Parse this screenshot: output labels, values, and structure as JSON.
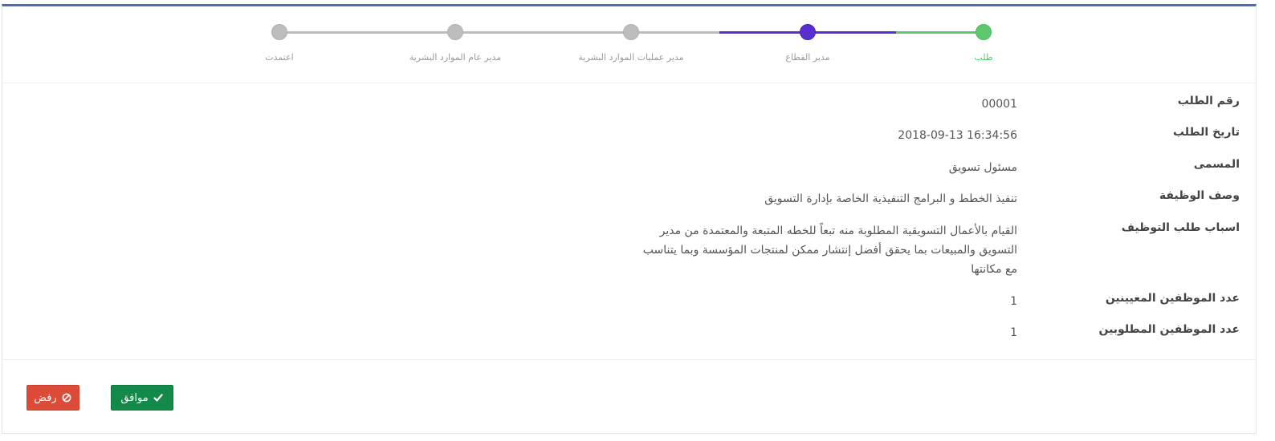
{
  "stepper": {
    "steps": [
      {
        "label": "طلب",
        "state": "done"
      },
      {
        "label": "مدير القطاع",
        "state": "active"
      },
      {
        "label": "مدير عمليات الموارد البشرية",
        "state": "pending"
      },
      {
        "label": "مدير عام الموارد البشرية",
        "state": "pending"
      },
      {
        "label": "اعتمدت",
        "state": "pending"
      }
    ],
    "colors": {
      "done": "#5cc96f",
      "active": "#5a2fd1",
      "pending": "#bdbdbd"
    }
  },
  "details": {
    "request_number": {
      "label": "رقم الطلب",
      "value": "00001"
    },
    "request_date": {
      "label": "تاريخ الطلب",
      "value": "2018-09-13 16:34:56"
    },
    "title": {
      "label": "المسمى",
      "value": "مسئول تسويق"
    },
    "job_description": {
      "label": "وصف الوظيفة",
      "value": "تنفيذ الخطط و البرامج التنفيذية الخاصة بإدارة التسويق"
    },
    "hiring_reasons": {
      "label": "اسباب طلب التوظيف",
      "value": "القيام بالأعمال التسويقية المطلوبة منه تبعاً للخطه المتبعة والمعتمدة من مدير التسويق والمبيعات بما يحقق أفضل إنتشار ممكن لمنتجات المؤسسة وبما يتناسب مع مكانتها"
    },
    "appointed_count": {
      "label": "عدد الموظفين المعيينين",
      "value": "1"
    },
    "required_count": {
      "label": "عدد الموظفين المطلوبين",
      "value": "1"
    }
  },
  "actions": {
    "approve_label": "موافق",
    "reject_label": "رفض",
    "approve_color": "#138a4a",
    "reject_color": "#dc4a38",
    "approve_icon": "check-icon",
    "reject_icon": "ban-icon"
  }
}
